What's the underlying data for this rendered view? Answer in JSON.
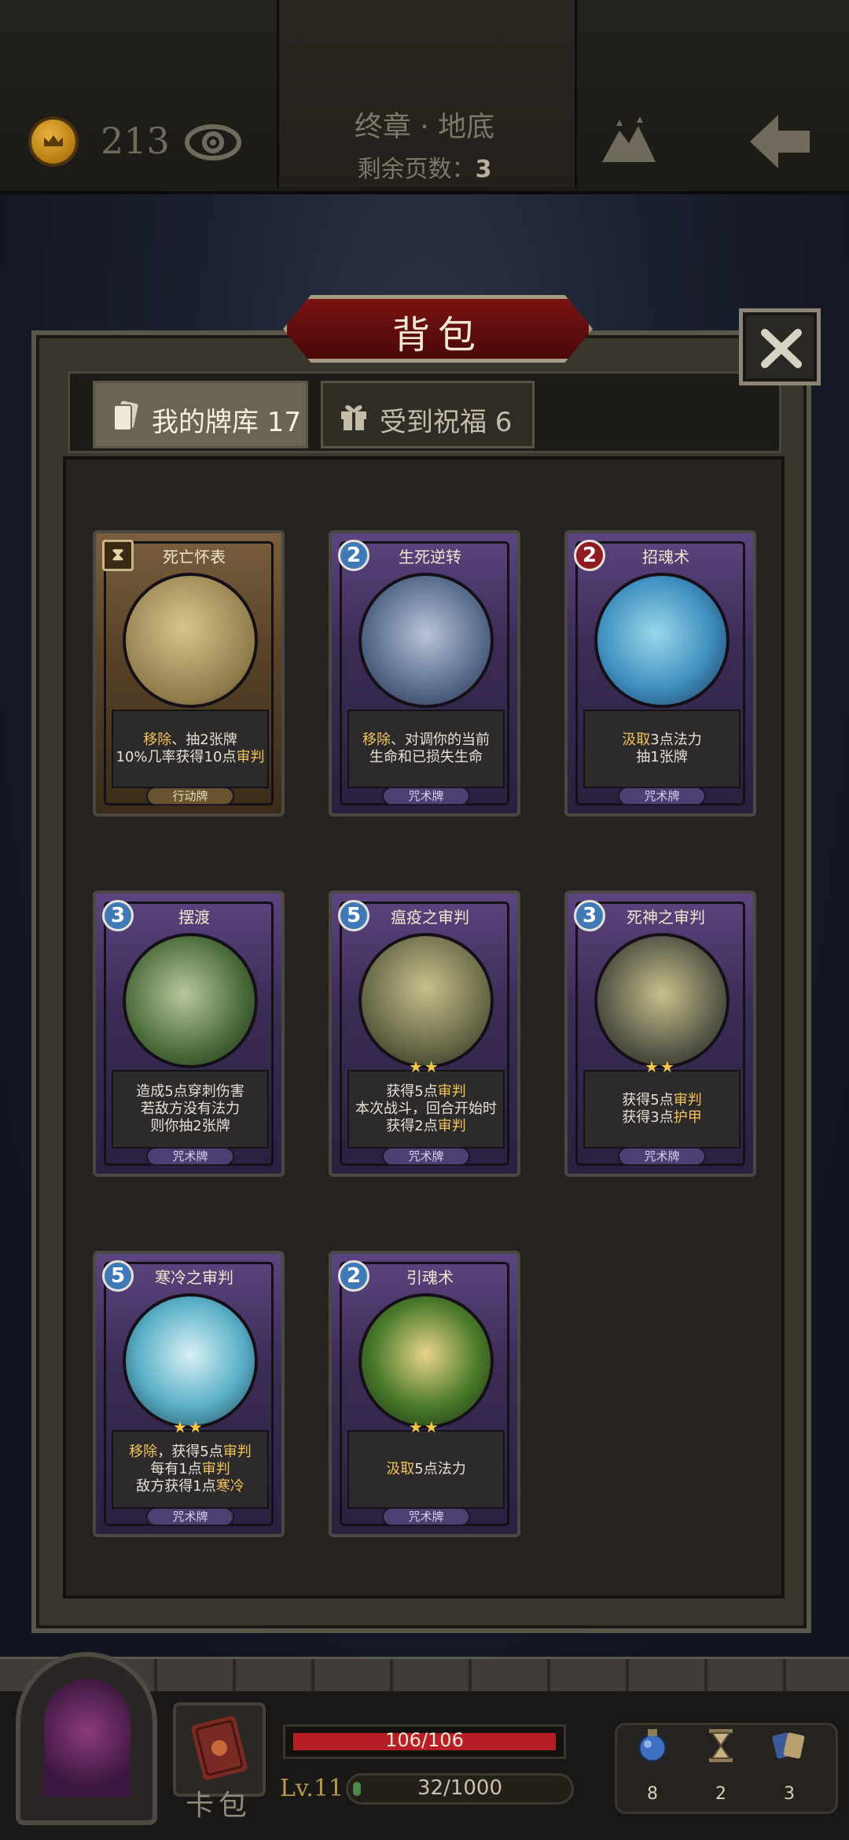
{
  "top_bar": {
    "coins": "213",
    "chapter_name": "终章 · 地底",
    "pages_left_label": "剩余页数：",
    "pages_left_value": "3"
  },
  "panel": {
    "title": "背包",
    "tabs": [
      {
        "label": "我的牌库 17",
        "active": true
      },
      {
        "label": "受到祝福 6",
        "active": false
      }
    ]
  },
  "cards": [
    {
      "name": "死亡怀表",
      "cost": "",
      "cost_style": "hourglass",
      "frame": "brown",
      "desc": [
        "<span class=\"hl\">移除</span>、抽2张牌",
        "10%几率获得10点<span class=\"hl\">审判</span>"
      ],
      "stars": 0,
      "type": "行动牌"
    },
    {
      "name": "生死逆转",
      "cost": "2",
      "cost_style": "blue",
      "frame": "purple",
      "desc": [
        "<span class=\"hl\">移除</span>、对调你的当前",
        "生命和已损失生命"
      ],
      "stars": 0,
      "type": "咒术牌"
    },
    {
      "name": "招魂术",
      "cost": "2",
      "cost_style": "red",
      "frame": "purple",
      "desc": [
        "<span class=\"hl\">汲取</span>3点法力",
        "抽1张牌"
      ],
      "stars": 0,
      "type": "咒术牌"
    },
    {
      "name": "摆渡",
      "cost": "3",
      "cost_style": "blue",
      "frame": "purple",
      "desc": [
        "造成5点穿刺伤害",
        "若敌方没有法力",
        "则你抽2张牌"
      ],
      "stars": 0,
      "type": "咒术牌"
    },
    {
      "name": "瘟疫之审判",
      "cost": "5",
      "cost_style": "blue",
      "frame": "purple",
      "desc": [
        "获得5点<span class=\"hl\">审判</span>",
        "本次战斗，回合开始时",
        "获得2点<span class=\"hl\">审判</span>"
      ],
      "stars": 2,
      "type": "咒术牌"
    },
    {
      "name": "死神之审判",
      "cost": "3",
      "cost_style": "blue",
      "frame": "purple",
      "desc": [
        "获得5点<span class=\"hl\">审判</span>",
        "获得3点<span class=\"hl\">护甲</span>"
      ],
      "stars": 2,
      "type": "咒术牌"
    },
    {
      "name": "寒冷之审判",
      "cost": "5",
      "cost_style": "blue",
      "frame": "purple",
      "desc": [
        "<span class=\"hl\">移除</span>，获得5点<span class=\"hl\">审判</span>",
        "每有1点<span class=\"hl\">审判</span>",
        "敌方获得1点<span class=\"hl\">寒冷</span>"
      ],
      "stars": 2,
      "type": "咒术牌"
    },
    {
      "name": "引魂术",
      "cost": "2",
      "cost_style": "blue",
      "frame": "purple",
      "desc": [
        "<span class=\"hl\">汲取</span>5点法力"
      ],
      "stars": 2,
      "type": "咒术牌"
    }
  ],
  "hud": {
    "card_bag_label": "卡包",
    "hp_text": "106/106",
    "hp_fraction": 1.0,
    "level": "Lv.11",
    "xp_text": "32/1000",
    "xp_fraction": 0.032,
    "stats": [
      {
        "icon": "potion-icon",
        "value": "8"
      },
      {
        "icon": "hourglass-icon",
        "value": "2"
      },
      {
        "icon": "cards-icon",
        "value": "3"
      }
    ]
  }
}
